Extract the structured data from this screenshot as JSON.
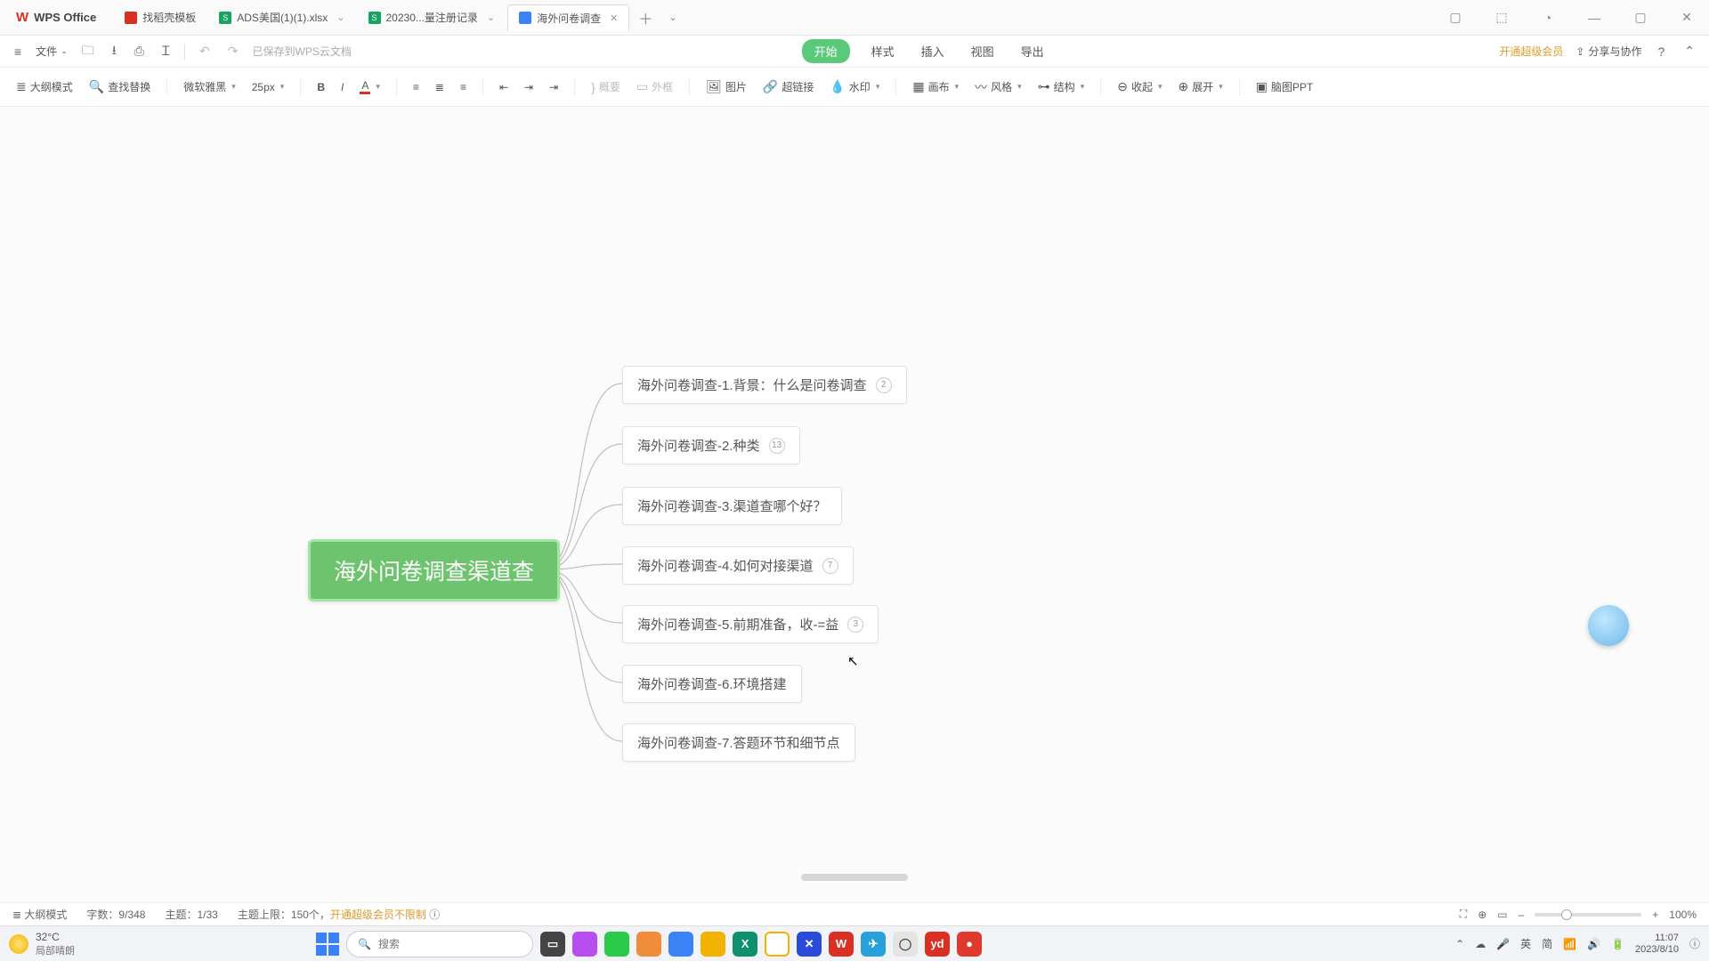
{
  "app": {
    "name": "WPS Office"
  },
  "tabs": [
    {
      "icon_bg": "#d93025",
      "label": "找稻壳模板"
    },
    {
      "icon_bg": "#1aa260",
      "icon_txt": "S",
      "label": "ADS美国(1)(1).xlsx"
    },
    {
      "icon_bg": "#1aa260",
      "icon_txt": "S",
      "label": "20230...量注册记录"
    },
    {
      "icon_bg": "#3b82f6",
      "label": "海外问卷调查",
      "active": true
    }
  ],
  "menubar": {
    "file": "文件",
    "saved": "已保存到WPS云文档",
    "tabs": [
      "开始",
      "样式",
      "插入",
      "视图",
      "导出"
    ],
    "vip": "开通超级会员",
    "share": "分享与协作"
  },
  "toolbar": {
    "outline": "大纲模式",
    "find": "查找替换",
    "font_family": "微软雅黑",
    "font_size": "25px",
    "summary": "概要",
    "frame": "外框",
    "image": "图片",
    "link": "超链接",
    "watermark": "水印",
    "canvas": "画布",
    "style": "风格",
    "structure": "结构",
    "collapse": "收起",
    "expand": "展开",
    "mindppt": "脑图PPT"
  },
  "mindmap": {
    "root": "海外问卷调查渠道查",
    "children": [
      {
        "label": "海外问卷调查-1.背景：什么是问卷调查",
        "badge": "2"
      },
      {
        "label": "海外问卷调查-2.种类",
        "badge": "13"
      },
      {
        "label": "海外问卷调查-3.渠道查哪个好？",
        "badge": ""
      },
      {
        "label": "海外问卷调查-4.如何对接渠道",
        "badge": "7"
      },
      {
        "label": "海外问卷调查-5.前期准备，收-=益",
        "badge": "3"
      },
      {
        "label": "海外问卷调查-6.环境搭建",
        "badge": ""
      },
      {
        "label": "海外问卷调查-7.答题环节和细节点",
        "badge": ""
      }
    ]
  },
  "status": {
    "outline": "大纲模式",
    "words_label": "字数：",
    "words": "9/348",
    "topics_label": "主题：",
    "topics": "1/33",
    "limit_label": "主题上限：150个，",
    "vip": "开通超级会员不限制",
    "zoom": "100%"
  },
  "os": {
    "temp": "32°C",
    "weather": "局部晴朗",
    "search_placeholder": "搜索",
    "ime": "英",
    "ime2": "简",
    "time": "11:07",
    "date": "2023/8/10"
  },
  "task_icons": [
    {
      "bg": "#444",
      "txt": "▭"
    },
    {
      "bg": "#b84df0",
      "txt": ""
    },
    {
      "bg": "#2bca4b",
      "txt": ""
    },
    {
      "bg": "#f08c3a",
      "txt": ""
    },
    {
      "bg": "#3b82f6",
      "txt": ""
    },
    {
      "bg": "#f2b200",
      "txt": ""
    },
    {
      "bg": "#0e8f6e",
      "txt": "X"
    },
    {
      "bg": "#fff",
      "txt": "",
      "ring": true
    },
    {
      "bg": "#2a4bd7",
      "txt": "✕"
    },
    {
      "bg": "#d93025",
      "txt": "W"
    },
    {
      "bg": "#29a0da",
      "txt": "✈"
    },
    {
      "bg": "#e4e4e4",
      "txt": "◯"
    },
    {
      "bg": "#d93025",
      "txt": "yd"
    },
    {
      "bg": "#e03a2f",
      "txt": "●"
    }
  ]
}
